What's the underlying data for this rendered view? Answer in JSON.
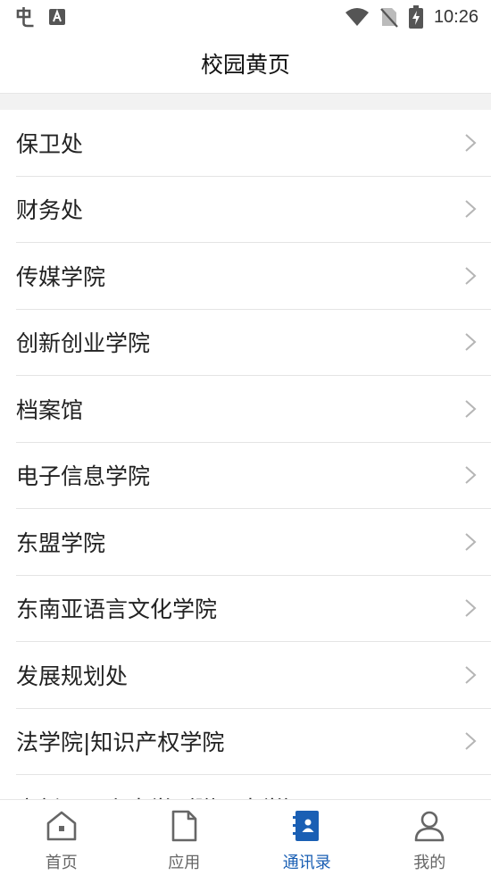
{
  "status_bar": {
    "time": "10:26"
  },
  "header": {
    "title": "校园黄页"
  },
  "departments": [
    {
      "label": "保卫处"
    },
    {
      "label": "财务处"
    },
    {
      "label": "传媒学院"
    },
    {
      "label": "创新创业学院"
    },
    {
      "label": "档案馆"
    },
    {
      "label": "电子信息学院"
    },
    {
      "label": "东盟学院"
    },
    {
      "label": "东南亚语言文化学院"
    },
    {
      "label": "发展规划处"
    },
    {
      "label": "法学院|知识产权学院"
    },
    {
      "label": "高新区日上中学（附属中学）"
    }
  ],
  "tabs": [
    {
      "label": "首页",
      "icon": "home-icon",
      "active": false
    },
    {
      "label": "应用",
      "icon": "document-icon",
      "active": false
    },
    {
      "label": "通讯录",
      "icon": "contacts-book-icon",
      "active": true
    },
    {
      "label": "我的",
      "icon": "person-icon",
      "active": false
    }
  ],
  "colors": {
    "accent": "#1a5fb4",
    "inactive": "#666666",
    "chevron": "#b5b5b5"
  }
}
